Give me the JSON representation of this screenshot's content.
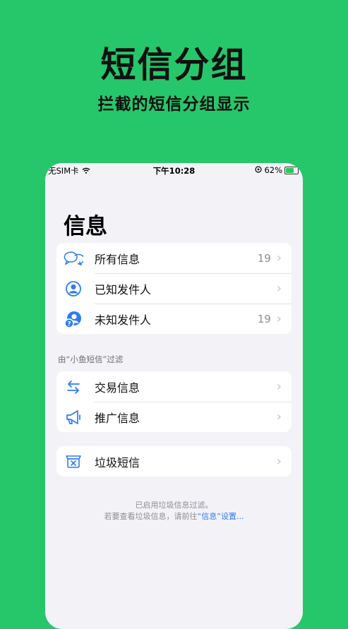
{
  "promo": {
    "title": "短信分组",
    "subtitle": "拦截的短信分组显示"
  },
  "status_bar": {
    "carrier": "无SIM卡",
    "time": "下午10:28",
    "battery": "62%"
  },
  "page_title": "信息",
  "main_group": [
    {
      "icon": "chat-bubbles-icon",
      "label": "所有信息",
      "count": "19"
    },
    {
      "icon": "person-circle-icon",
      "label": "已知发件人",
      "count": ""
    },
    {
      "icon": "unknown-person-icon",
      "label": "未知发件人",
      "count": "19"
    }
  ],
  "filter_section_label": "由“小鱼短信”过滤",
  "filter_group": [
    {
      "icon": "transaction-arrows-icon",
      "label": "交易信息"
    },
    {
      "icon": "megaphone-icon",
      "label": "推广信息"
    }
  ],
  "junk_group": [
    {
      "icon": "junk-box-icon",
      "label": "垃圾短信"
    }
  ],
  "footer": {
    "line1": "已启用垃圾信息过滤。",
    "line2_prefix": "若要查看垃圾信息，请前往",
    "line2_link": "“信息”设置..."
  },
  "colors": {
    "background": "#26c76b",
    "accent": "#2f7bf5",
    "battery": "#2bc653"
  }
}
